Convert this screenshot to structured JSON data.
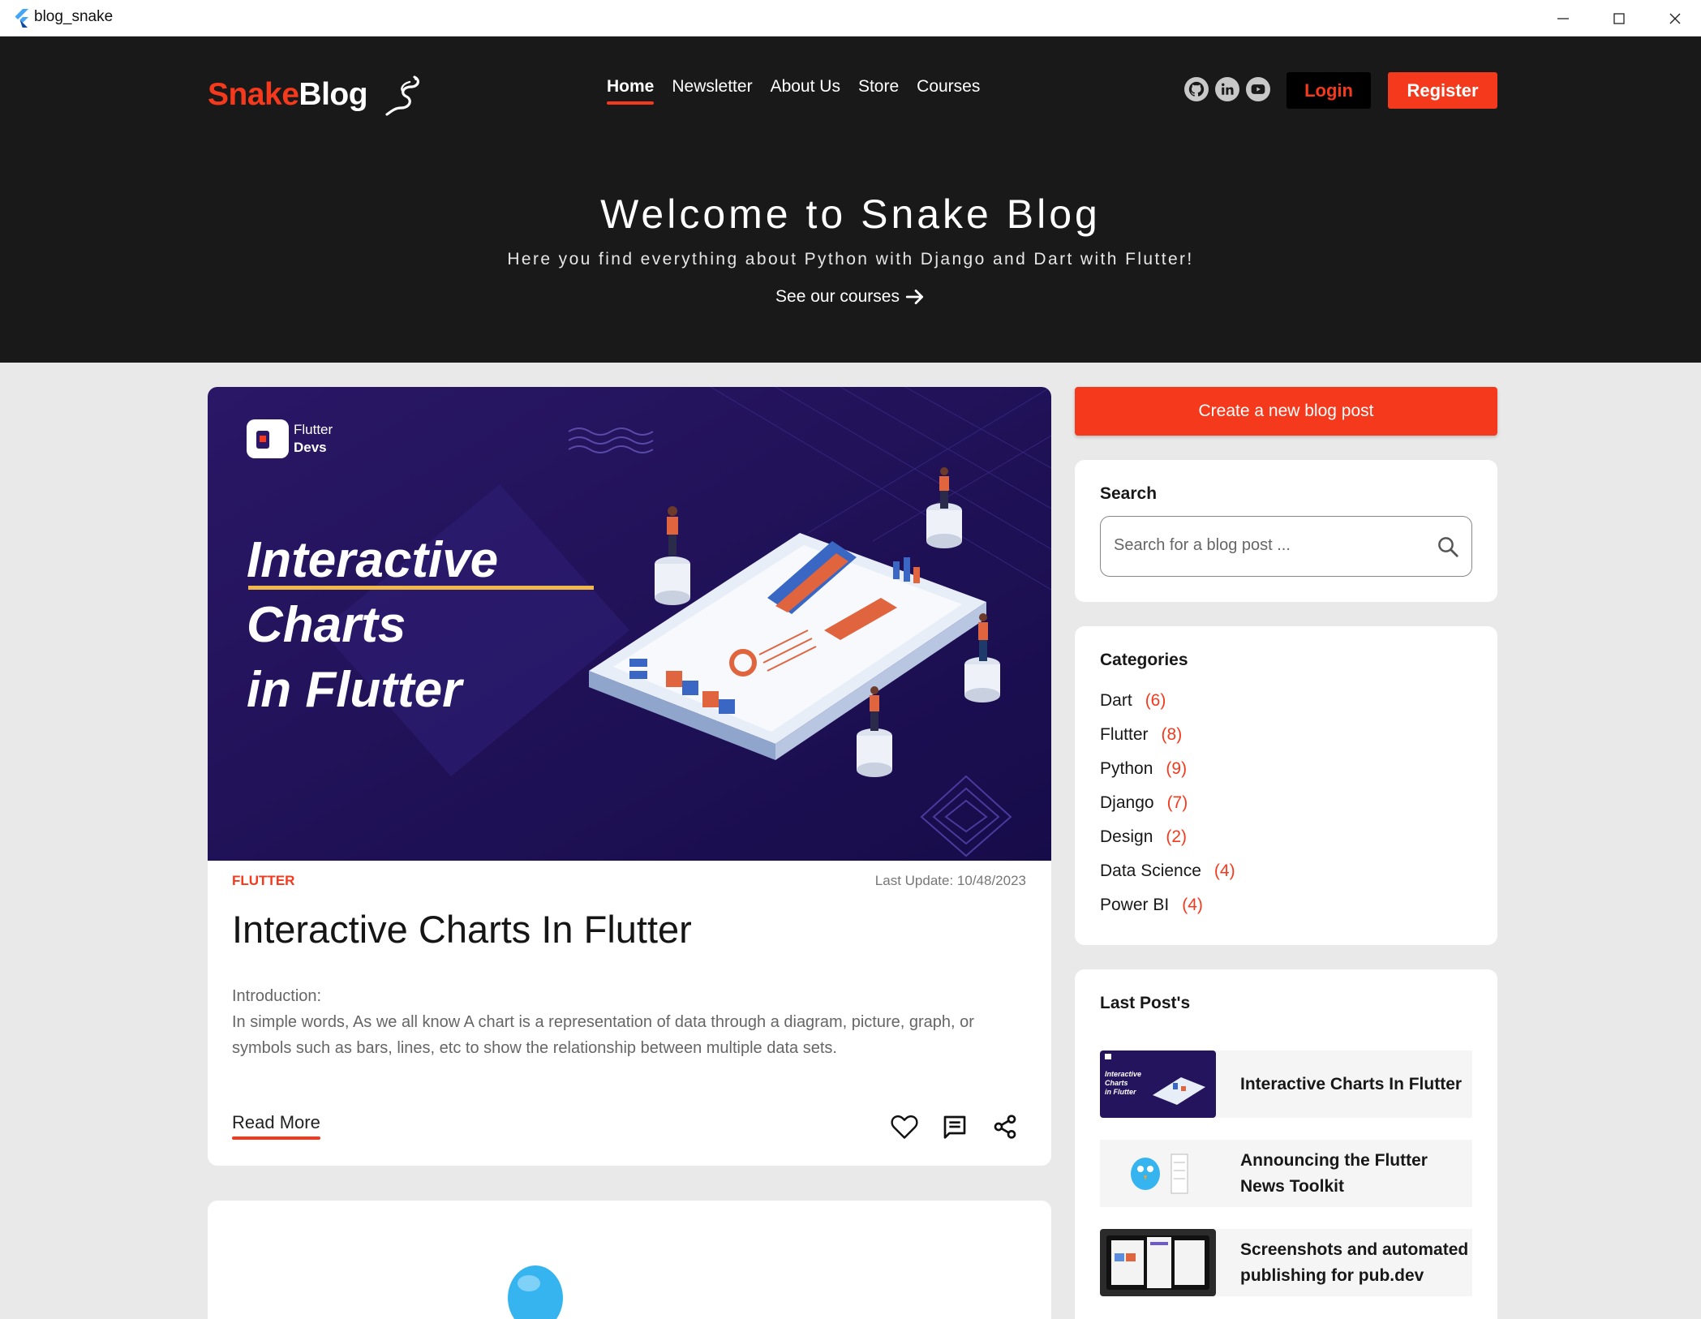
{
  "window": {
    "title": "blog_snake"
  },
  "header": {
    "logo_part1": "Snake",
    "logo_part2": "Blog",
    "nav": [
      {
        "label": "Home",
        "active": true
      },
      {
        "label": "Newsletter"
      },
      {
        "label": "About Us"
      },
      {
        "label": "Store"
      },
      {
        "label": "Courses"
      }
    ],
    "socials": [
      "github-icon",
      "linkedin-icon",
      "youtube-icon"
    ],
    "login_label": "Login",
    "register_label": "Register",
    "hero_title": "Welcome to Snake Blog",
    "hero_subtitle": "Here you find everything about Python with Django and Dart with Flutter!",
    "hero_link": "See our courses"
  },
  "article": {
    "image": {
      "brand_top": "Flutter",
      "brand_bottom": "Devs",
      "line1": "Interactive",
      "line2": "Charts",
      "line3": "in Flutter"
    },
    "category": "FLUTTER",
    "date": "Last Update: 10/48/2023",
    "title": "Interactive Charts In Flutter",
    "intro_heading": "Introduction:",
    "intro_body": "In simple words, As we all know A chart is a representation of data through a diagram, picture, graph, or symbols such as bars, lines, etc to show the relationship between multiple data sets.",
    "read_more": "Read More",
    "actions": [
      "heart-icon",
      "comment-icon",
      "share-icon"
    ]
  },
  "sidebar": {
    "create_label": "Create a new blog post",
    "search_heading": "Search",
    "search_placeholder": "Search for a blog post ...",
    "categories_heading": "Categories",
    "categories": [
      {
        "name": "Dart",
        "count": "(6)"
      },
      {
        "name": "Flutter",
        "count": "(8)"
      },
      {
        "name": "Python",
        "count": "(9)"
      },
      {
        "name": "Django",
        "count": "(7)"
      },
      {
        "name": "Design",
        "count": "(2)"
      },
      {
        "name": "Data Science",
        "count": "(4)"
      },
      {
        "name": "Power BI",
        "count": "(4)"
      }
    ],
    "last_heading": "Last Post's",
    "last_posts": [
      {
        "title": "Interactive Charts In Flutter"
      },
      {
        "title": "Announcing the Flutter News Toolkit"
      },
      {
        "title": "Screenshots and automated publishing for pub.dev"
      }
    ]
  },
  "colors": {
    "accent": "#f5391c",
    "header_bg": "#191919",
    "page_bg": "#e9e9e9",
    "image_bg": "#24145e"
  }
}
